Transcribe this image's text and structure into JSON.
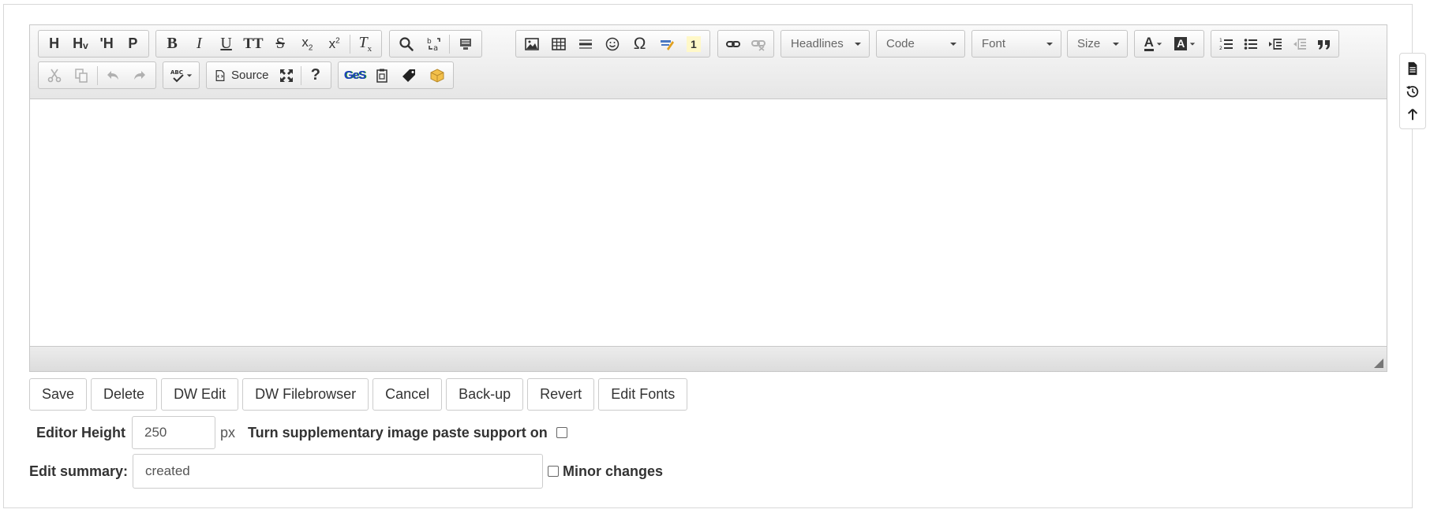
{
  "toolbar": {
    "row1": {
      "headings": [
        "H",
        "Hᵥ",
        "'H",
        "P"
      ],
      "headlines_label": "Headlines",
      "code_label": "Code",
      "font_label": "Font",
      "size_label": "Size",
      "special_char": "Ω",
      "numbered_badge": "1"
    },
    "row2": {
      "source_label": "Source",
      "help_label": "?",
      "ges_label": "GeS"
    }
  },
  "actions": {
    "save": "Save",
    "delete": "Delete",
    "dw_edit": "DW Edit",
    "dw_filebrowser": "DW Filebrowser",
    "cancel": "Cancel",
    "backup": "Back-up",
    "revert": "Revert",
    "edit_fonts": "Edit Fonts"
  },
  "settings": {
    "editor_height_label": "Editor Height",
    "editor_height_value": "250",
    "editor_height_unit": "px",
    "paste_support_label": "Turn supplementary image paste support on",
    "paste_support_checked": false
  },
  "summary": {
    "label": "Edit summary:",
    "value": "created",
    "minor_changes_label": "Minor changes",
    "minor_changes_checked": false
  },
  "side_dock": {
    "icons": [
      "page-icon",
      "history-icon",
      "back-to-top-icon"
    ]
  },
  "colors": {
    "toolbar_gradient_top": "#fafafa",
    "toolbar_gradient_bottom": "#e6e6e6",
    "border": "#c8c8c8"
  }
}
